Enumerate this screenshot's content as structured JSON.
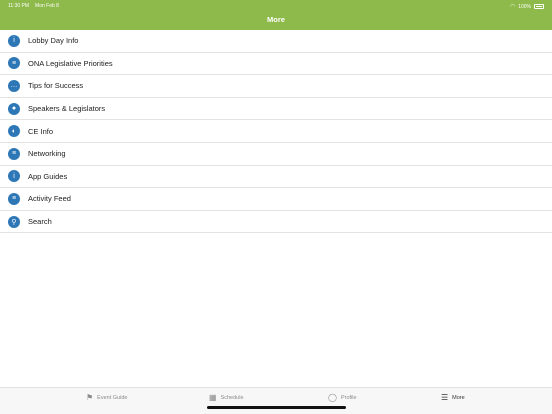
{
  "status": {
    "time": "11:30 PM",
    "date": "Mon Feb 8",
    "battery": "100%"
  },
  "header": {
    "title": "More"
  },
  "menu": [
    {
      "label": "Lobby Day Info",
      "icon": "info-icon"
    },
    {
      "label": "ONA Legislative Priorities",
      "icon": "list-icon"
    },
    {
      "label": "Tips for Success",
      "icon": "chat-icon"
    },
    {
      "label": "Speakers & Legislators",
      "icon": "person-icon"
    },
    {
      "label": "CE Info",
      "icon": "ce-icon"
    },
    {
      "label": "Networking",
      "icon": "list-icon"
    },
    {
      "label": "App Guides",
      "icon": "info-icon"
    },
    {
      "label": "Activity Feed",
      "icon": "list-icon"
    },
    {
      "label": "Search",
      "icon": "search-icon"
    }
  ],
  "tabs": [
    {
      "label": "Event Guide",
      "icon": "signpost-icon"
    },
    {
      "label": "Schedule",
      "icon": "calendar-icon"
    },
    {
      "label": "Profile",
      "icon": "person-icon"
    },
    {
      "label": "More",
      "icon": "menu-icon"
    }
  ],
  "colors": {
    "header": "#8dba4a",
    "icon": "#2e77b7"
  }
}
